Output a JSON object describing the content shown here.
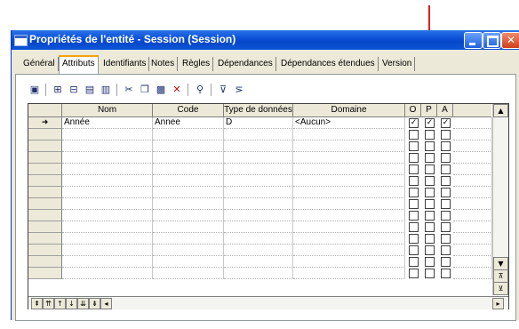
{
  "window": {
    "title": "Propriétés de l'entité - Session (Session)"
  },
  "tabs": [
    {
      "label": "Général"
    },
    {
      "label": "Attributs"
    },
    {
      "label": "Identifiants"
    },
    {
      "label": "Notes"
    },
    {
      "label": "Règles"
    },
    {
      "label": "Dépendances"
    },
    {
      "label": "Dépendances étendues"
    },
    {
      "label": "Version"
    }
  ],
  "active_tab": "Attributs",
  "toolbar": {
    "icons": [
      "properties-icon",
      "add-row-icon",
      "insert-row-icon",
      "add-attributes-icon",
      "replicate-icon",
      "cut-icon",
      "copy-icon",
      "paste-icon",
      "delete-icon",
      "find-icon",
      "customize-columns-icon",
      "filter-icon"
    ]
  },
  "grid": {
    "columns": [
      "Nom",
      "Code",
      "Type de données",
      "Domaine",
      "O",
      "P",
      "A"
    ],
    "rows": [
      {
        "indicator": "➜",
        "nom": "Année",
        "code": "Annee",
        "type": "D",
        "domaine": "<Aucun>",
        "o": true,
        "p": true,
        "a": true
      }
    ],
    "empty_rows": 13
  },
  "navigation": [
    "⇞",
    "⇈",
    "↑",
    "↓",
    "⇊",
    "⇟",
    "◂"
  ],
  "accent_colors": {
    "arrow": "#e02020",
    "titlebar": "#0a4fd6"
  }
}
